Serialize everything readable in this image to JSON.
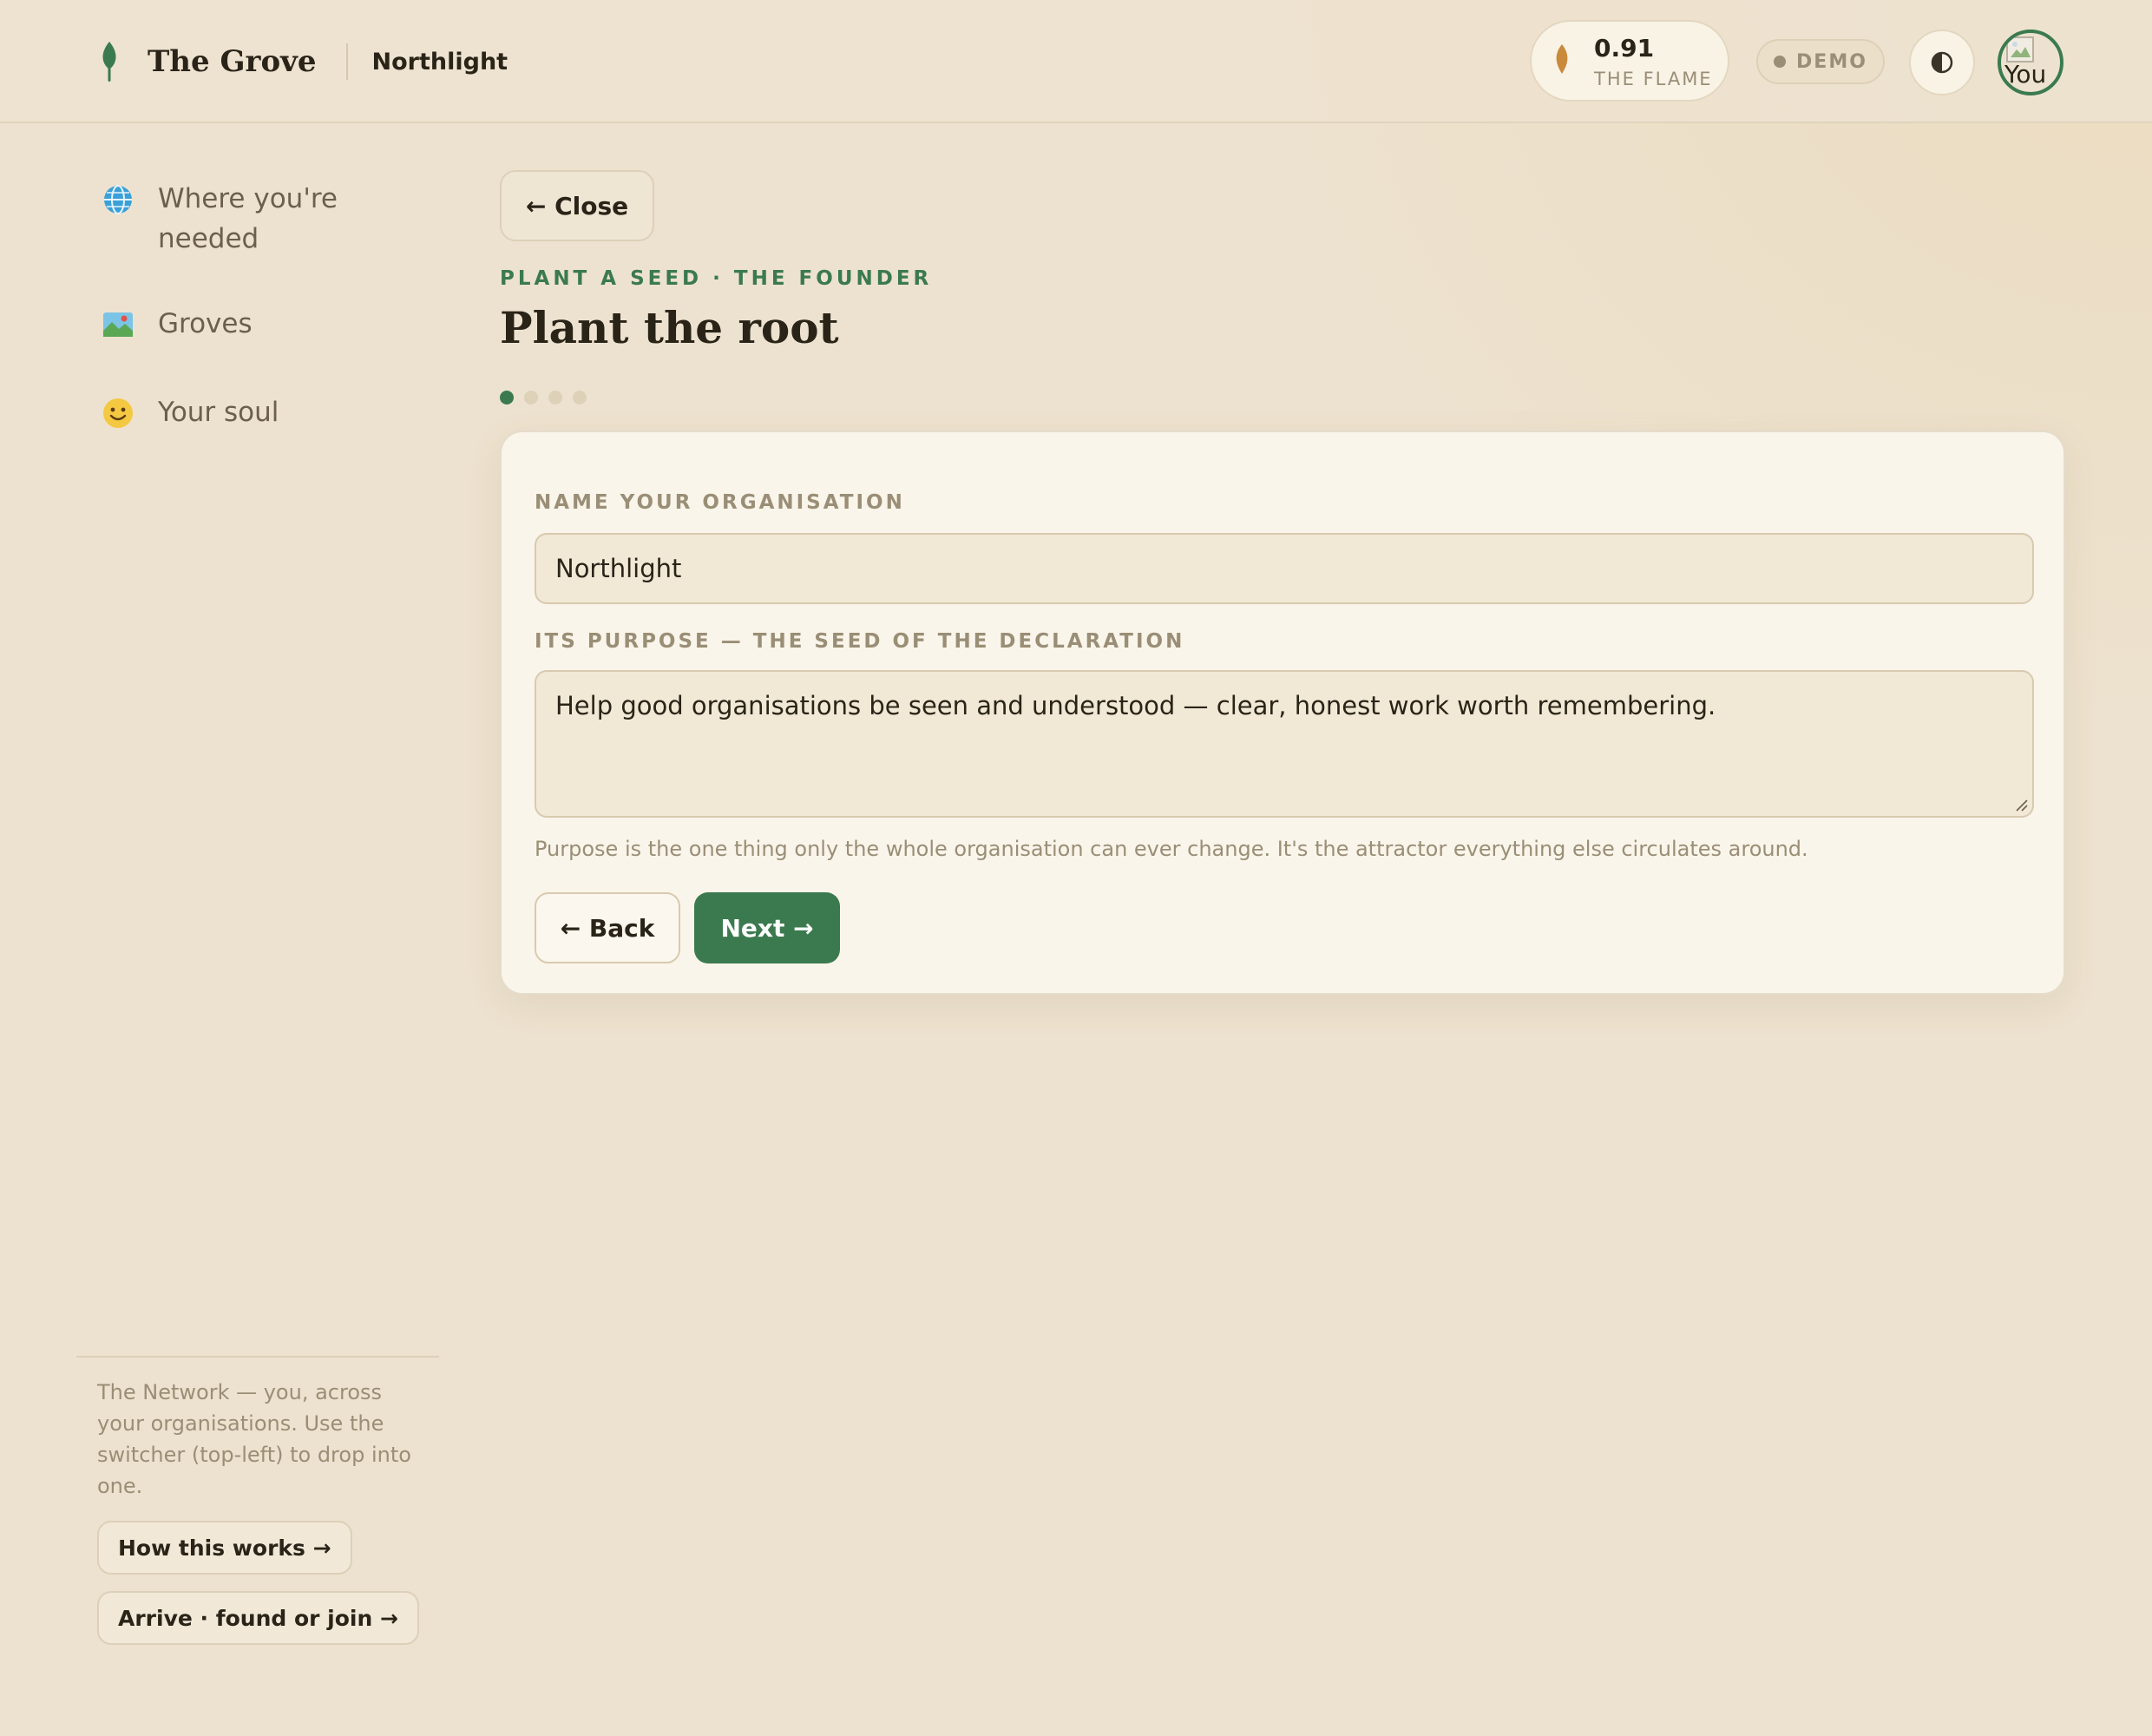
{
  "header": {
    "brand_name": "The Grove",
    "org_name": "Northlight",
    "flame": {
      "value": "0.91",
      "label": "THE FLAME"
    },
    "demo_label": "DEMO",
    "theme_toggle_glyph": "◐",
    "avatar_alt": "You"
  },
  "sidebar": {
    "items": [
      {
        "icon": "globe-icon",
        "glyph": "🌐",
        "label": "Where you're needed"
      },
      {
        "icon": "map-icon",
        "glyph": "🗺️",
        "label": "Groves"
      },
      {
        "icon": "smile-icon",
        "glyph": "🙂",
        "label": "Your soul"
      }
    ],
    "note": "The Network — you, across your organisations. Use the switcher (top-left) to drop into one.",
    "how_button": "How this works →",
    "arrive_button": "Arrive · found or join →"
  },
  "main": {
    "close_button": "← Close",
    "eyebrow": "PLANT A SEED · THE FOUNDER",
    "title": "Plant the root",
    "steps": {
      "current": 1,
      "total": 4
    },
    "form": {
      "name_label": "NAME YOUR ORGANISATION",
      "name_value": "Northlight",
      "purpose_label": "ITS PURPOSE — THE SEED OF THE DECLARATION",
      "purpose_value": "Help good organisations be seen and understood — clear, honest work worth remembering.",
      "help_text": "Purpose is the one thing only the whole organisation can ever change. It's the attractor everything else circulates around.",
      "back_button": "← Back",
      "next_button": "Next →"
    }
  },
  "colors": {
    "background": "#ede2cf",
    "accent_green": "#3b7a4f",
    "flame_orange": "#c98a3c",
    "muted_text": "#9a8e76"
  }
}
